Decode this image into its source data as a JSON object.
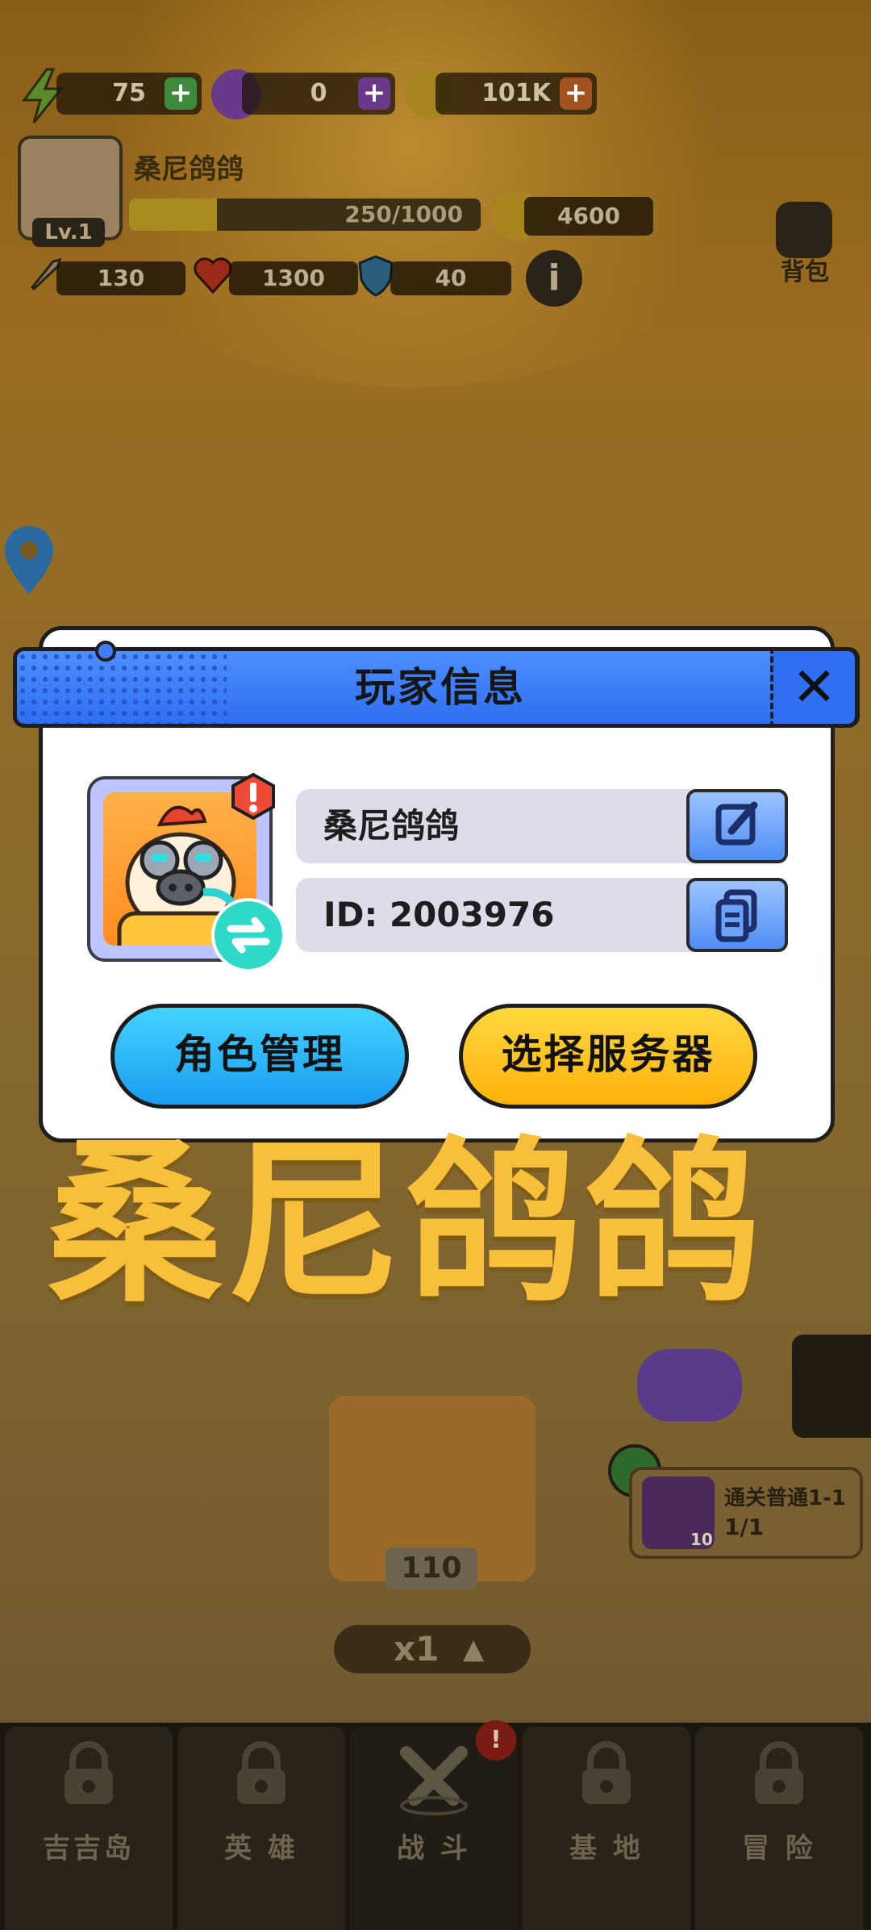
{
  "hud": {
    "energy": "75",
    "gems": "0",
    "coins": "101K",
    "player_name": "桑尼鸽鸽",
    "level": "Lv.1",
    "exp": "250/1000",
    "exp_fraction": 0.25,
    "power": "4600",
    "attack": "130",
    "hp": "1300",
    "defense": "40",
    "backpack_label": "背包"
  },
  "world": {
    "chest_count": "110",
    "speed_label": "x1",
    "quest_title": "通关普通1-1",
    "quest_progress": "1/1",
    "quest_reward_count": "10"
  },
  "nav": {
    "tabs": [
      {
        "label": "吉吉岛"
      },
      {
        "label": "英 雄"
      },
      {
        "label": "战 斗"
      },
      {
        "label": "基 地"
      },
      {
        "label": "冒 险"
      }
    ]
  },
  "dialog": {
    "title": "玩家信息",
    "name_value": "桑尼鸽鸽",
    "id_value": "ID: 2003976",
    "role_button": "角色管理",
    "server_button": "选择服务器"
  },
  "overlay_caption": "桑尼鸽鸽",
  "colors": {
    "header_blue": "#2f6ff2",
    "role_button": "#1a9cf0",
    "server_button": "#ffb20a",
    "caption": "#f8bf3b"
  }
}
